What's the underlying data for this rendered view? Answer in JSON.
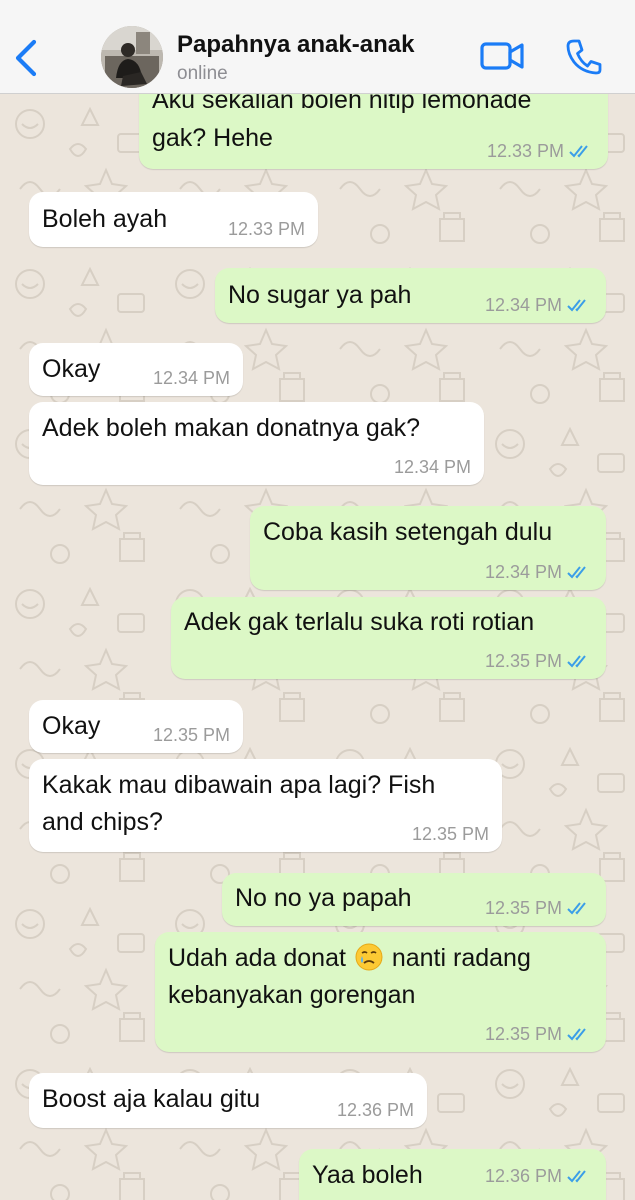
{
  "header": {
    "contact_name": "Papahnya anak-anak",
    "status": "online",
    "icons": {
      "back": "chevron-left-icon",
      "video": "video-camera-icon",
      "call": "phone-icon"
    },
    "accent_color": "#1b7cf6"
  },
  "colors": {
    "incoming_bubble": "#ffffff",
    "outgoing_bubble": "#dcf8c6",
    "read_ticks": "#3b9ee8",
    "timestamp": "#9b9b9b"
  },
  "messages": [
    {
      "direction": "out",
      "lines": [
        "Aku sekalian boleh nitip lemonade",
        "gak? Hehe"
      ],
      "time": "12.33 PM",
      "read": true
    },
    {
      "direction": "in",
      "lines": [
        "Boleh ayah"
      ],
      "time": "12.33 PM"
    },
    {
      "direction": "out",
      "lines": [
        "No sugar ya pah"
      ],
      "time": "12.34 PM",
      "read": true
    },
    {
      "direction": "in",
      "lines": [
        "Okay"
      ],
      "time": "12.34 PM"
    },
    {
      "direction": "in",
      "lines": [
        "Adek boleh makan donatnya gak?"
      ],
      "time": "12.34 PM"
    },
    {
      "direction": "out",
      "lines": [
        "Coba kasih setengah dulu"
      ],
      "time": "12.34 PM",
      "read": true
    },
    {
      "direction": "out",
      "lines": [
        "Adek gak terlalu suka roti rotian"
      ],
      "time": "12.35 PM",
      "read": true
    },
    {
      "direction": "in",
      "lines": [
        "Okay"
      ],
      "time": "12.35 PM"
    },
    {
      "direction": "in",
      "lines": [
        "Kakak mau dibawain apa lagi? Fish",
        "and chips?"
      ],
      "time": "12.35 PM"
    },
    {
      "direction": "out",
      "lines": [
        "No no ya papah"
      ],
      "time": "12.35 PM",
      "read": true
    },
    {
      "direction": "out",
      "lines_parts": [
        [
          "Udah ada donat",
          "crying-face-emoji",
          "nanti radang"
        ],
        "kebanyakan gorengan"
      ],
      "line1_before": "Udah ada donat",
      "line1_after": "nanti radang",
      "line2": "kebanyakan gorengan",
      "emoji": "crying-face-emoji",
      "time": "12.35 PM",
      "read": true
    },
    {
      "direction": "in",
      "lines": [
        "Boost aja kalau gitu"
      ],
      "time": "12.36 PM"
    },
    {
      "direction": "out",
      "lines": [
        "Yaa boleh"
      ],
      "time": "12.36 PM",
      "read": true
    }
  ]
}
